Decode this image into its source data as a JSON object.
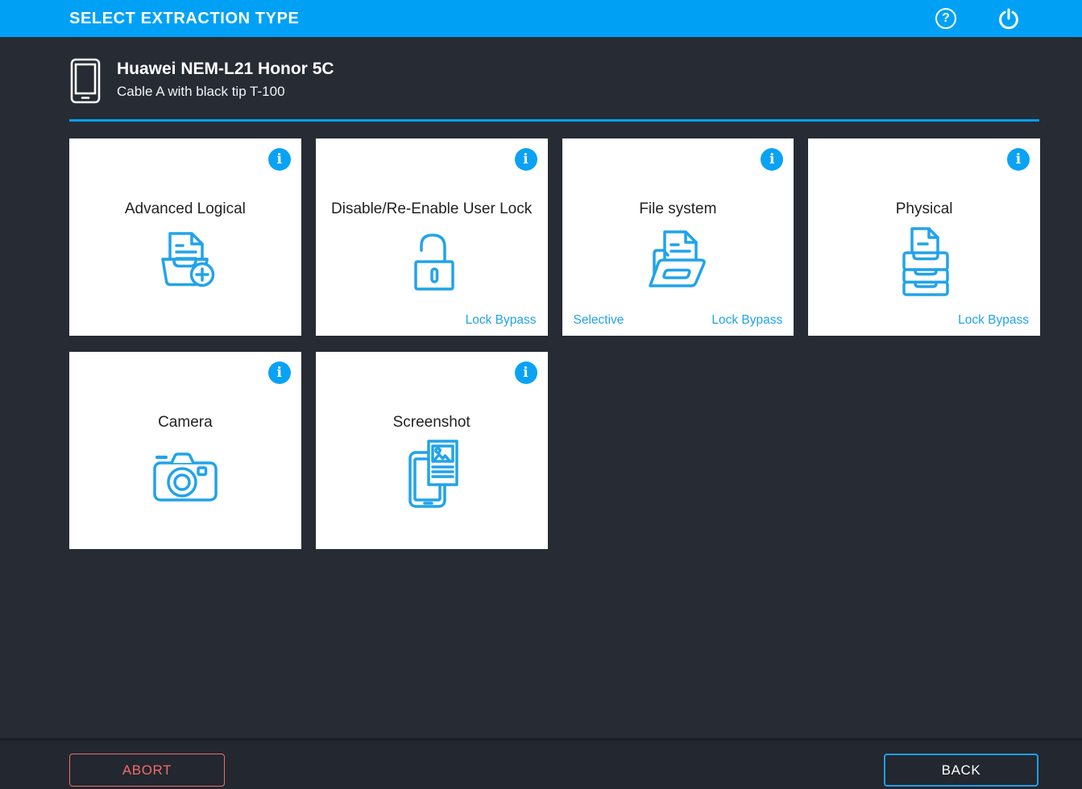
{
  "header": {
    "title": "SELECT EXTRACTION TYPE"
  },
  "device": {
    "name": "Huawei NEM-L21 Honor 5C",
    "cable": "Cable A with black tip T-100"
  },
  "icons": {
    "help_glyph": "?",
    "info_glyph": "i"
  },
  "colors": {
    "accent_blue": "#00a1f5",
    "icon_blue": "#21a3ea",
    "background_dark": "#262b34",
    "footer_dark": "#23272f",
    "abort_red": "#ee6c68",
    "card_white": "#ffffff"
  },
  "cards": [
    {
      "title": "Advanced Logical",
      "icon": "tray-plus"
    },
    {
      "title": "Disable/Re-Enable User Lock",
      "icon": "unlock",
      "badge_right": "Lock Bypass"
    },
    {
      "title": "File system",
      "icon": "folder-document",
      "badge_left": "Selective",
      "badge_right": "Lock Bypass"
    },
    {
      "title": "Physical",
      "icon": "drawer-stack",
      "badge_right": "Lock Bypass"
    },
    {
      "title": "Camera",
      "icon": "camera"
    },
    {
      "title": "Screenshot",
      "icon": "phone-screenshot"
    }
  ],
  "footer": {
    "abort_label": "ABORT",
    "back_label": "BACK"
  }
}
